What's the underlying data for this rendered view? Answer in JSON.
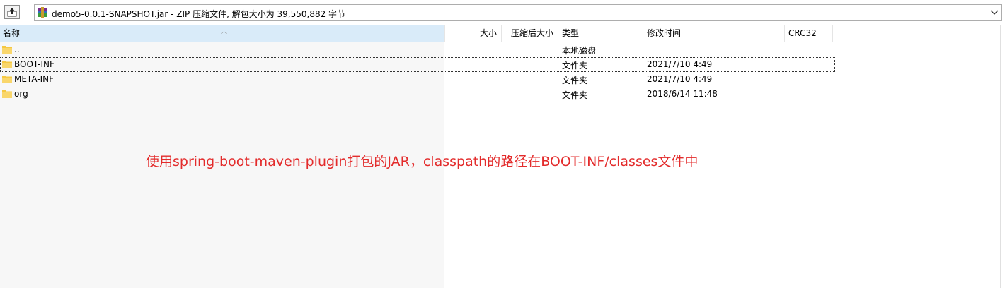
{
  "address_bar": {
    "path": "demo5-0.0.1-SNAPSHOT.jar - ZIP 压缩文件, 解包大小为 39,550,882 字节"
  },
  "columns": {
    "name": "名称",
    "size": "大小",
    "packed": "压缩后大小",
    "type": "类型",
    "modified": "修改时间",
    "crc": "CRC32"
  },
  "files": [
    {
      "name": "..",
      "type": "本地磁盘",
      "modified": ""
    },
    {
      "name": "BOOT-INF",
      "type": "文件夹",
      "modified": "2021/7/10 4:49"
    },
    {
      "name": "META-INF",
      "type": "文件夹",
      "modified": "2021/7/10 4:49"
    },
    {
      "name": "org",
      "type": "文件夹",
      "modified": "2018/6/14 11:48"
    }
  ],
  "annotation": "使用spring-boot-maven-plugin打包的JAR，classpath的路径在BOOT-INF/classes文件中",
  "colors": {
    "annotation": "#e32b2b",
    "folder": "#f5c842",
    "header_highlight": "#d9ebf9"
  }
}
